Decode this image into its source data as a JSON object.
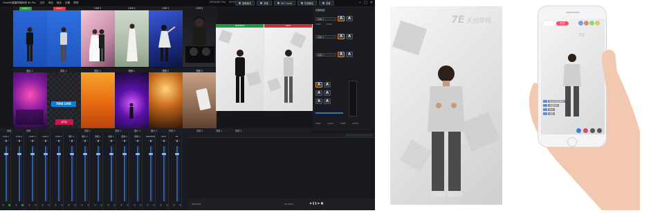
{
  "app": {
    "title": "OneStS直播导播系统 4K Pro",
    "menu": [
      "文件",
      "添加",
      "输出",
      "设置",
      "帮助"
    ],
    "status": [
      "1080p/60 25p",
      "00:00"
    ],
    "toolbar": [
      {
        "label": "直播推流",
        "icon": "broadcast-icon"
      },
      {
        "label": "录像",
        "icon": "record-icon"
      },
      {
        "label": "ISO Cloud",
        "icon": "cloud-icon"
      },
      {
        "label": "外部输出",
        "icon": "output-icon"
      },
      {
        "label": "设置",
        "icon": "gear-icon"
      }
    ],
    "window_controls": [
      "─",
      "□",
      "✕"
    ]
  },
  "sources": [
    {
      "label": "CAM 1",
      "tag": "CAM 1",
      "tag_color": "#2f9e44"
    },
    {
      "label": "CAM 2",
      "tag": "CAM 2",
      "tag_color": "#d43c3c"
    },
    {
      "label": "CAM 3",
      "tag": "CAM 3",
      "tag_color": ""
    },
    {
      "label": "CAM 4",
      "tag": "CAM 4",
      "tag_color": ""
    },
    {
      "label": "CAM 5",
      "tag": "CAM 5",
      "tag_color": ""
    },
    {
      "label": "CAM 6",
      "tag": "CAM 6",
      "tag_color": ""
    },
    {
      "label": "图片 1",
      "tag": "",
      "tag_color": ""
    },
    {
      "label": "图片 1",
      "tag": "",
      "tag_color": ""
    },
    {
      "label": "图片 2",
      "tag": "",
      "tag_color": ""
    },
    {
      "label": "视频 1",
      "tag": "",
      "tag_color": ""
    },
    {
      "label": "视频 2",
      "tag": "",
      "tag_color": ""
    },
    {
      "label": "视频 3",
      "tag": "",
      "tag_color": ""
    }
  ],
  "source_overlays": {
    "live_text": "THIS LIVE",
    "play_text": "play"
  },
  "preview": {
    "label": "PREVIEW",
    "color": "#1f9a3a"
  },
  "program": {
    "label": "PGM",
    "color": "#cc2f2f"
  },
  "right_panel": {
    "title": "切换特效",
    "rows": [
      {
        "label": "切换 1",
        "value": "切换 1"
      },
      {
        "label": "切换 2",
        "value": "切换 2"
      },
      {
        "label": "切换 3",
        "value": "切换 3"
      }
    ],
    "take_labels": [
      "TAKE",
      "AUTO"
    ],
    "bottom_labels": [
      "TAKE",
      "AUTO",
      "TAKE",
      "AUTO"
    ],
    "slider_label": "音量"
  },
  "bottom_tabs": [
    "音频",
    "视频",
    "视频 1",
    "视频 2",
    "图片 1",
    "图片 2",
    "视频 3",
    "视频 4",
    "视频 1",
    "视频 2"
  ],
  "mixer": {
    "channels": [
      "CAM 1",
      "CAM 2",
      "CAM 3",
      "CAM 4",
      "CAM 5",
      "图片 1",
      "图片 2",
      "视频 1",
      "视频 2",
      "视频 3",
      "视频 4",
      "PREVIEW",
      "PGM",
      "RL"
    ]
  },
  "events": {
    "footer_left": "00:00:00",
    "footer_mid": "00:00:00"
  },
  "phone": {
    "logo": "天创华视",
    "logo_mark": "7E",
    "chat_tag": "关注",
    "comments": [
      "欢迎来到直播间",
      "主播好帅",
      "666",
      "点赞"
    ]
  },
  "colors": {
    "accent": "#4a90e2",
    "live": "#cc2f2f",
    "ok": "#1f9a3a"
  }
}
